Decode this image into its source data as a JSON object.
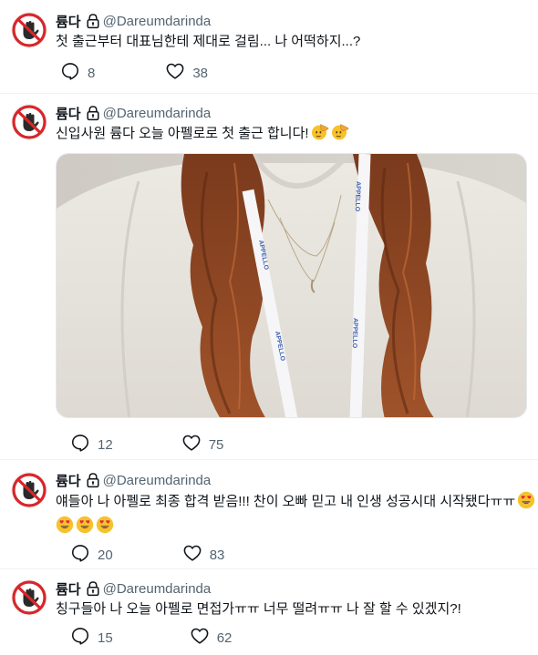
{
  "tweets": [
    {
      "name": "륨다",
      "handle": "@Dareumdarinda",
      "text_lines": [
        "첫 출근부터 대표님한테 제대로 걸림... 나 어떡하지...?"
      ],
      "replies": "8",
      "likes": "38"
    },
    {
      "name": "륨다",
      "handle": "@Dareumdarinda",
      "text_lines": [
        "신입사원 륨다 오늘 아펠로로 첫 출근 합니다!"
      ],
      "emoji_after": [
        "salute-face-emoji",
        "salute-face-emoji"
      ],
      "image_texts": [
        "APPELLO",
        "APPELLO",
        "APPELLO",
        "APPELLO"
      ],
      "replies": "12",
      "likes": "75"
    },
    {
      "name": "륨다",
      "handle": "@Dareumdarinda",
      "text_lines": [
        "얘들아 나 아펠로 최종 합격 받음!!! 찬이 오빠 믿고 내 인생 성공시대 시작됐다ㅠㅠ"
      ],
      "emoji_after": [
        "heart-eyes-emoji",
        "heart-eyes-emoji",
        "heart-eyes-emoji",
        "heart-eyes-emoji"
      ],
      "replies": "20",
      "likes": "83"
    },
    {
      "name": "륨다",
      "handle": "@Dareumdarinda",
      "text_lines": [
        "칭구들아 나 오늘 아펠로 면접가ㅠㅠ 너무 떨려ㅠㅠ 나 잘 할 수 있겠지?!"
      ],
      "replies": "15",
      "likes": "62"
    }
  ],
  "colors": {
    "text": "#0f1419",
    "muted": "#536471",
    "divider": "#eff3f4",
    "avatar_ring": "#d7262a"
  }
}
